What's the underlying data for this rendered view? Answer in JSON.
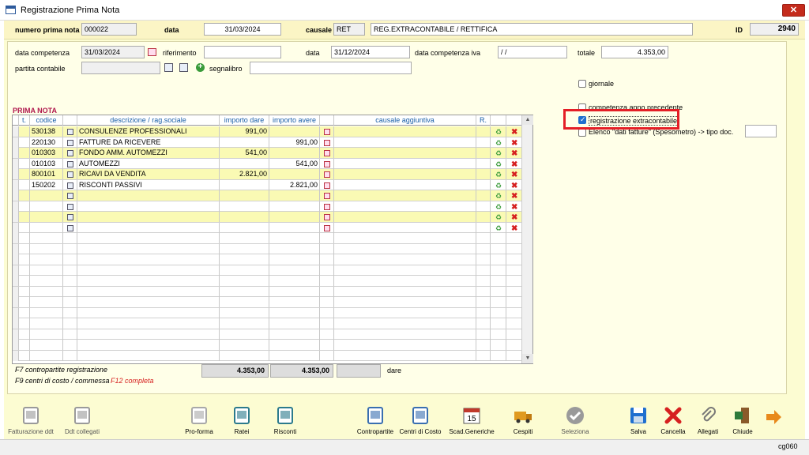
{
  "window": {
    "title": "Registrazione Prima Nota",
    "close_label": "✕"
  },
  "header": {
    "numero_label": "numero prima nota",
    "numero_value": "000022",
    "data_label": "data",
    "data_value": "31/03/2024",
    "causale_label": "causale",
    "causale_code": "RET",
    "causale_desc": "REG.EXTRACONTABILE / RETTIFICA",
    "id_label": "ID",
    "id_value": "2940"
  },
  "form": {
    "data_competenza_label": "data competenza",
    "data_competenza_value": "31/03/2024",
    "riferimento_label": "riferimento",
    "riferimento_value": "",
    "data_label": "data",
    "data_value": "31/12/2024",
    "data_competenza_iva_label": "data competenza iva",
    "data_competenza_iva_value": " / /",
    "totale_label": "totale",
    "totale_value": "4.353,00",
    "partita_label": "partita contabile",
    "partita_value": "",
    "segnalibro_label": "segnalibro",
    "segnalibro_value": ""
  },
  "options": {
    "giornale": "giornale",
    "competenza": "competenza anno precedente",
    "extracontabile": "registrazione extracontabile",
    "elenco": "Elenco \"dati fatture\" (Spesometro) -> tipo doc."
  },
  "section_title": "PRIMA NOTA",
  "grid": {
    "headers": [
      "t.",
      "codice",
      "",
      "descrizione / rag.sociale",
      "importo dare",
      "importo avere",
      "",
      "causale aggiuntiva",
      "R.",
      "",
      ""
    ],
    "rows": [
      {
        "codice": "530138",
        "desc": "CONSULENZE PROFESSIONALI",
        "dare": "991,00",
        "avere": ""
      },
      {
        "codice": "220130",
        "desc": "FATTURE DA RICEVERE",
        "dare": "",
        "avere": "991,00"
      },
      {
        "codice": "010303",
        "desc": "FONDO AMM. AUTOMEZZI",
        "dare": "541,00",
        "avere": ""
      },
      {
        "codice": "010103",
        "desc": "AUTOMEZZI",
        "dare": "",
        "avere": "541,00"
      },
      {
        "codice": "800101",
        "desc": "RICAVI DA VENDITA",
        "dare": "2.821,00",
        "avere": ""
      },
      {
        "codice": "150202",
        "desc": "RISCONTI PASSIVI",
        "dare": "",
        "avere": "2.821,00"
      },
      {
        "codice": "",
        "desc": "",
        "dare": "",
        "avere": ""
      },
      {
        "codice": "",
        "desc": "",
        "dare": "",
        "avere": ""
      },
      {
        "codice": "",
        "desc": "",
        "dare": "",
        "avere": ""
      },
      {
        "codice": "",
        "desc": "",
        "dare": "",
        "avere": ""
      }
    ]
  },
  "footer": {
    "hint_f7": "F7 contropartite registrazione",
    "hint_f9": "F9 centri di costo / commessa",
    "hint_f12": "F12 completa",
    "total_dare": "4.353,00",
    "total_avere": "4.353,00",
    "balance": "",
    "dare_label": "dare"
  },
  "toolbar": [
    {
      "label": "Fatturazione ddt",
      "icon": "invoice-icon"
    },
    {
      "label": "Ddt collegati",
      "icon": "linked-ddt-icon"
    },
    {
      "label": "Pro-forma",
      "icon": "proforma-icon"
    },
    {
      "label": "Ratei",
      "icon": "calculator-icon"
    },
    {
      "label": "Risconti",
      "icon": "calculator-icon"
    },
    {
      "label": "Contropartite",
      "icon": "columns-icon"
    },
    {
      "label": "Centri di Costo",
      "icon": "org-chart-icon"
    },
    {
      "label": "Scad.Generiche",
      "icon": "calendar-icon"
    },
    {
      "label": "Cespiti",
      "icon": "truck-icon"
    },
    {
      "label": "Seleziona",
      "icon": "check-circle-icon"
    },
    {
      "label": "Salva",
      "icon": "floppy-icon"
    },
    {
      "label": "Cancella",
      "icon": "delete-x-icon"
    },
    {
      "label": "Allegati",
      "icon": "paperclip-icon"
    },
    {
      "label": "Chiude",
      "icon": "exit-door-icon"
    }
  ],
  "status": {
    "code": "cg060"
  },
  "colors": {
    "accent_red": "#e41e26",
    "section_title": "#b0184e",
    "header_blue": "#1a5fa8"
  }
}
